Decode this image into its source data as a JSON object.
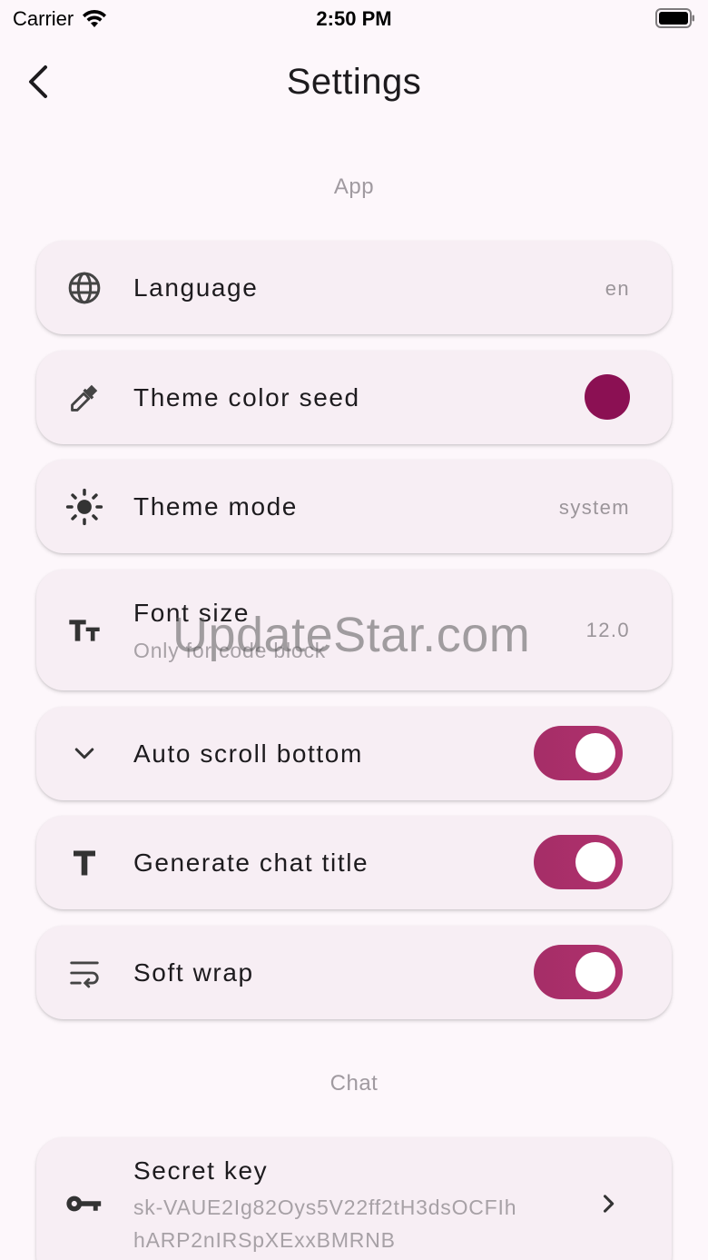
{
  "status_bar": {
    "carrier": "Carrier",
    "time": "2:50 PM"
  },
  "app_bar": {
    "title": "Settings"
  },
  "sections": {
    "app": "App",
    "chat": "Chat"
  },
  "settings": {
    "language": {
      "label": "Language",
      "value": "en",
      "icon": "globe-icon"
    },
    "theme_color_seed": {
      "label": "Theme color seed",
      "color": "#8b1053",
      "icon": "eyedropper-icon"
    },
    "theme_mode": {
      "label": "Theme mode",
      "value": "system",
      "icon": "brightness-icon"
    },
    "font_size": {
      "label": "Font size",
      "subtitle": "Only for code block",
      "value": "12.0",
      "icon": "text-size-icon"
    },
    "auto_scroll_bottom": {
      "label": "Auto scroll bottom",
      "enabled": true,
      "icon": "chevron-down-icon"
    },
    "generate_chat_title": {
      "label": "Generate chat title",
      "enabled": true,
      "icon": "title-icon"
    },
    "soft_wrap": {
      "label": "Soft wrap",
      "enabled": true,
      "icon": "wrap-text-icon"
    },
    "secret_key": {
      "label": "Secret key",
      "value_line1": "sk-VAUE2Ig82Oys5V22ff2tH3dsOCFIh",
      "value_line2": "hARP2nIRSpXExxBMRNB",
      "icon": "key-icon"
    }
  },
  "watermark": "UpdateStar.com",
  "colors": {
    "accent": "#a52e67",
    "card": "#f7eef4",
    "background": "#fdf7fb"
  }
}
